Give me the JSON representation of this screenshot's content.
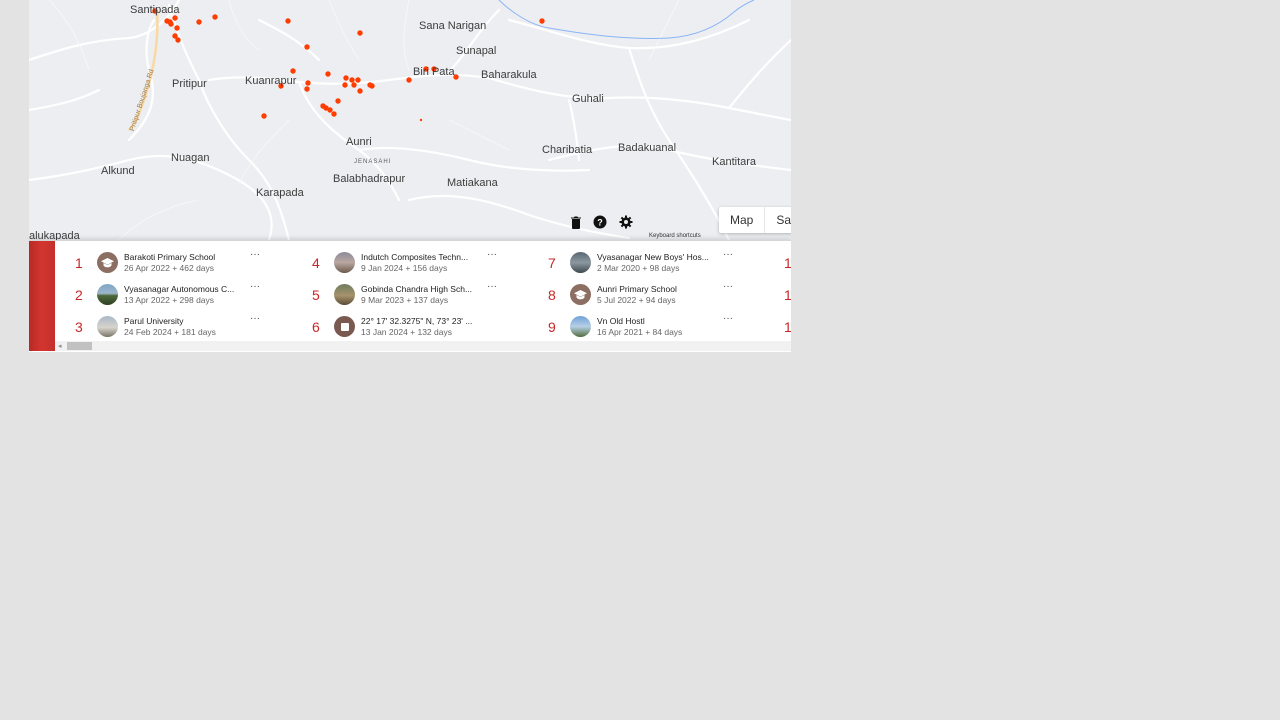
{
  "map": {
    "places": [
      "Santipada",
      "Sana Narigan",
      "Sunapal",
      "Pritipur",
      "Kuanrapur",
      "Biri Pata",
      "Baharakula",
      "Guhali",
      "Aunri",
      "JENASAHI",
      "Charibatia",
      "Badakuanal",
      "Kantitara",
      "Nuagan",
      "Alkund",
      "Balabhadrapur",
      "Matiakana",
      "Karapada",
      "alukapada"
    ],
    "road_label": "Pritipur Boujanga Rd",
    "view_toggle": [
      "Map",
      "Sa"
    ],
    "keyboard_shortcuts": "Keyboard shortcuts",
    "marker_color": "#ff3d00",
    "controls": [
      "trash-icon",
      "help-icon",
      "gear-icon"
    ]
  },
  "panel": {
    "accent_color": "#d3352f",
    "items": [
      {
        "num": "1",
        "title": "Barakoti Primary School",
        "sub": "26 Apr 2022 + 462 days",
        "thumb": "school-icon",
        "more": "···"
      },
      {
        "num": "2",
        "title": "Vyasanagar Autonomous C...",
        "sub": "13 Apr 2022 + 298 days",
        "thumb": "photo",
        "more": "···"
      },
      {
        "num": "3",
        "title": "Parul University",
        "sub": "24 Feb 2024 + 181 days",
        "thumb": "photo",
        "more": "···"
      },
      {
        "num": "4",
        "title": "Indutch Composites Techn...",
        "sub": "9 Jan 2024 + 156 days",
        "thumb": "photo",
        "more": "···"
      },
      {
        "num": "5",
        "title": "Gobinda Chandra High Sch...",
        "sub": "9 Mar 2023 + 137 days",
        "thumb": "photo",
        "more": "···"
      },
      {
        "num": "6",
        "title": "22° 17' 32.3275\" N, 73° 23' ...",
        "sub": "13 Jan 2024 + 132 days",
        "thumb": "square-icon",
        "more": ""
      },
      {
        "num": "7",
        "title": "Vyasanagar New Boys' Hos...",
        "sub": "2 Mar 2020 + 98 days",
        "thumb": "photo",
        "more": "···"
      },
      {
        "num": "8",
        "title": "Aunri Primary School",
        "sub": "5 Jul 2022 + 94 days",
        "thumb": "school-icon",
        "more": "···"
      },
      {
        "num": "9",
        "title": "Vn Old Hostl",
        "sub": "16 Apr 2021 + 84 days",
        "thumb": "photo",
        "more": "···"
      }
    ],
    "peek_nums": [
      "1",
      "1",
      "1"
    ]
  }
}
